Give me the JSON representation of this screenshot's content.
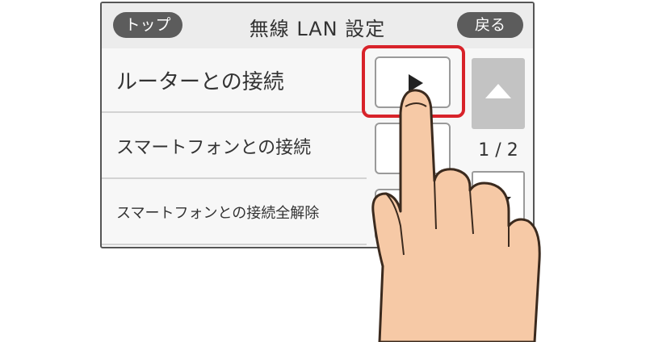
{
  "header": {
    "top_label": "トップ",
    "title": "無線 LAN 設定",
    "back_label": "戻る"
  },
  "menu": {
    "items": [
      {
        "label": "ルーターとの接続"
      },
      {
        "label": "スマートフォンとの接続"
      },
      {
        "label": "スマートフォンとの接続全解除"
      }
    ]
  },
  "pager": {
    "indicator": "1 / 2"
  },
  "icons": {
    "go": "play-arrow-icon",
    "up": "triangle-up-icon",
    "down": "triangle-down-icon",
    "hand": "pointing-hand-icon"
  },
  "colors": {
    "highlight": "#d8232a",
    "pill": "#5c5c5c",
    "skin": "#f6c9a6"
  }
}
